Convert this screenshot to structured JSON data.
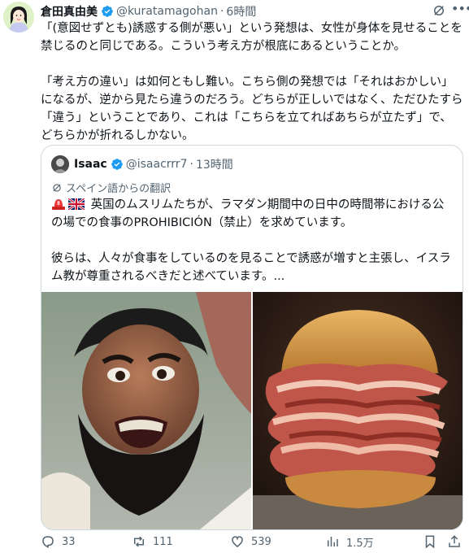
{
  "tweet": {
    "author_name": "倉田真由美",
    "author_handle": "@kuratamagohan",
    "separator": "·",
    "time": "6時間",
    "paragraphs": [
      "「(意図せずとも)誘惑する側が悪い」という発想は、女性が身体を見せることを禁じるのと同じである。こういう考え方が根底にあるということか。",
      "「考え方の違い」は如何ともし難い。こちら側の発想では「それはおかしい」になるが、逆から見たら違うのだろう。どちらが正しいではなく、ただひたすら「違う」ということであり、これは「こちらを立てればあちらが立たず」で、どちらかが折れるしかない。"
    ]
  },
  "quote": {
    "author_name": "Isaac",
    "author_handle": "@isaacrrr7",
    "separator": "·",
    "time": "13時間",
    "translated_label": "スペイン語からの翻訳",
    "paragraphs": [
      "英国のムスリムたちが、ラマダン期間中の日中の時間帯における公の場での食事のPROHIBICIÓN（禁止）を求めています。",
      "彼らは、人々が食事をしているのを見ることで誘惑が増すと主張し、イスラム教が尊重されるべきだと述べています。..."
    ]
  },
  "actions": {
    "replies": "33",
    "reposts": "111",
    "likes": "539",
    "views": "1.5万"
  },
  "colors": {
    "text": "#0f1419",
    "secondary": "#536471",
    "verified_blue": "#1d9bf0",
    "border": "#cfd9de"
  },
  "icons": [
    "verified-badge-icon",
    "grok-icon",
    "more-icon",
    "translate-icon",
    "reply-icon",
    "repost-icon",
    "like-icon",
    "views-icon",
    "bookmark-icon",
    "share-icon"
  ]
}
